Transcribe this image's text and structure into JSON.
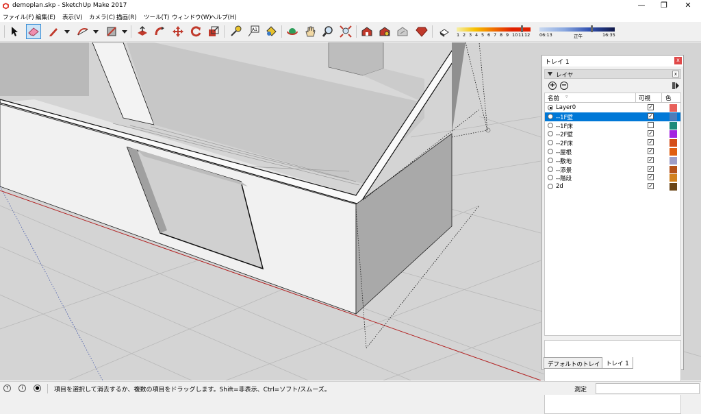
{
  "window": {
    "title": "demoplan.skp - SketchUp Make 2017",
    "minimize": "—",
    "restore": "❐",
    "close": "✕"
  },
  "menu": [
    "ファイル(F)",
    "編集(E)",
    "表示(V)",
    "カメラ(C)",
    "描画(R)",
    "ツール(T)",
    "ウィンドウ(W)",
    "ヘルプ(H)"
  ],
  "toolbar": {
    "tools": [
      "select",
      "eraser",
      "pencil",
      "arc",
      "rectangle",
      "push-pull",
      "follow-me",
      "move",
      "rotate",
      "scale",
      "tape-measure",
      "text",
      "paint-bucket",
      "orbit",
      "pan",
      "zoom",
      "zoom-extents",
      "warehouse",
      "extension-warehouse",
      "share-model",
      "ruby",
      "shadows"
    ],
    "shadow_months": [
      "1",
      "2",
      "3",
      "4",
      "5",
      "6",
      "7",
      "8",
      "9",
      "10",
      "11",
      "12"
    ],
    "shadow_time_start": "06:13",
    "shadow_time_noon": "正午",
    "shadow_time_end": "16:35"
  },
  "tray": {
    "title": "トレイ 1",
    "close": "x",
    "panel_title": "レイヤ",
    "panel_close": "x",
    "add_icon": "+",
    "remove_icon": "−",
    "columns": {
      "name": "名前",
      "visible": "可視",
      "color": "色"
    },
    "layers": [
      {
        "name": "Layer0",
        "active": true,
        "selected": false,
        "visible": true,
        "color": "#e8605a"
      },
      {
        "name": "--1F壁",
        "active": false,
        "selected": true,
        "visible": true,
        "color": "#4f7cb9"
      },
      {
        "name": "--1F床",
        "active": false,
        "selected": false,
        "visible": false,
        "color": "#1d8a7a"
      },
      {
        "name": "--2F壁",
        "active": false,
        "selected": false,
        "visible": true,
        "color": "#a424e0"
      },
      {
        "name": "--2F床",
        "active": false,
        "selected": false,
        "visible": true,
        "color": "#d44e19"
      },
      {
        "name": "--屋根",
        "active": false,
        "selected": false,
        "visible": true,
        "color": "#e05e10"
      },
      {
        "name": "--敷地",
        "active": false,
        "selected": false,
        "visible": true,
        "color": "#9e9ec8"
      },
      {
        "name": "--添景",
        "active": false,
        "selected": false,
        "visible": true,
        "color": "#b5521a"
      },
      {
        "name": "--階段",
        "active": false,
        "selected": false,
        "visible": true,
        "color": "#d2811e"
      },
      {
        "name": "2d",
        "active": false,
        "selected": false,
        "visible": true,
        "color": "#6b4517"
      }
    ],
    "tabs": [
      "デフォルトのトレイ",
      "トレイ 1"
    ]
  },
  "status": {
    "message": "項目を選択して消去するか、複数の項目をドラッグします。Shift=非表示、Ctrl=ソフト/スムーズ。",
    "measure_label": "測定",
    "measure_value": ""
  }
}
